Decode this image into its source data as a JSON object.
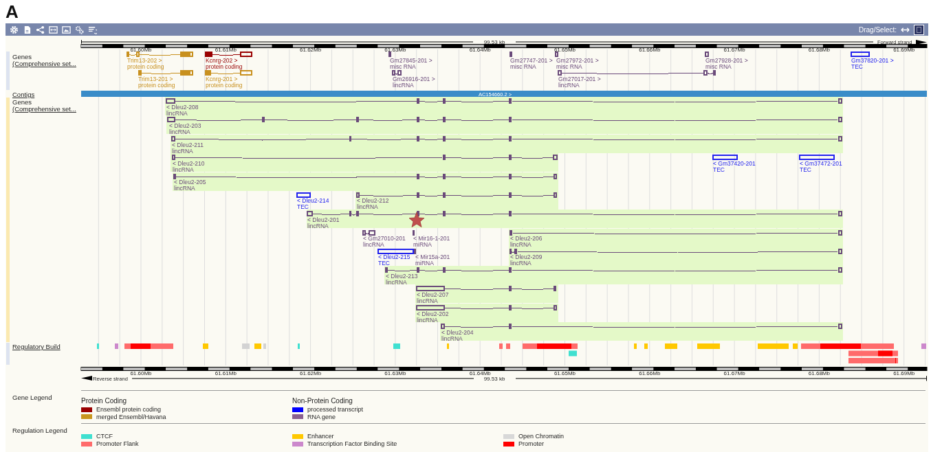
{
  "figure_label": "A",
  "toolbar": {
    "drag_select_label": "Drag/Select:"
  },
  "top_ruler": {
    "span": "99.53 kb",
    "strand": "Forward strand",
    "ticks": [
      "61.60Mb",
      "61.61Mb",
      "61.62Mb",
      "61.63Mb",
      "61.64Mb",
      "61.65Mb",
      "61.66Mb",
      "61.67Mb",
      "61.68Mb",
      "61.69Mb"
    ]
  },
  "forward_genes": {
    "label": "Genes",
    "sublabel": "(Comprehensive set...",
    "genes": [
      {
        "name": "Trim13-202 >",
        "biotype": "protein coding",
        "color": "#c8901e"
      },
      {
        "name": "Kcnrg-202 >",
        "biotype": "protein coding",
        "color": "#990000"
      },
      {
        "name": "Gm27845-201 >",
        "biotype": "misc RNA",
        "color": "#6a4a7a"
      },
      {
        "name": "Gm27747-201 >",
        "biotype": "misc RNA",
        "color": "#6a4a7a"
      },
      {
        "name": "Gm27972-201 >",
        "biotype": "misc RNA",
        "color": "#6a4a7a"
      },
      {
        "name": "Gm27928-201 >",
        "biotype": "misc RNA",
        "color": "#6a4a7a"
      },
      {
        "name": "Gm37820-201 >",
        "biotype": "TEC",
        "color": "#2222ee"
      },
      {
        "name": "Trim13-201 >",
        "biotype": "protein coding",
        "color": "#c8901e"
      },
      {
        "name": "Kcnrg-201 >",
        "biotype": "protein coding",
        "color": "#c8901e"
      },
      {
        "name": "Gm26916-201 >",
        "biotype": "lincRNA",
        "color": "#6a4a7a"
      },
      {
        "name": "Gm27017-201 >",
        "biotype": "lincRNA",
        "color": "#6a4a7a"
      }
    ]
  },
  "contigs": {
    "label": "Contigs",
    "contig": "AC154660.2 >"
  },
  "reverse_genes": {
    "label": "Genes",
    "sublabel": "(Comprehensive set...",
    "genes": [
      {
        "name": "< Dleu2-208",
        "biotype": "lincRNA",
        "color": "#6a4a7a",
        "highlighted": true
      },
      {
        "name": "< Dleu2-203",
        "biotype": "lincRNA",
        "color": "#6a4a7a",
        "highlighted": true
      },
      {
        "name": "< Dleu2-211",
        "biotype": "lincRNA",
        "color": "#6a4a7a",
        "highlighted": true
      },
      {
        "name": "< Dleu2-210",
        "biotype": "lincRNA",
        "color": "#6a4a7a",
        "highlighted": true
      },
      {
        "name": "< Gm37420-201",
        "biotype": "TEC",
        "color": "#2222ee",
        "highlighted": false
      },
      {
        "name": "< Gm37472-201",
        "biotype": "TEC",
        "color": "#2222ee",
        "highlighted": false
      },
      {
        "name": "< Dleu2-205",
        "biotype": "lincRNA",
        "color": "#6a4a7a",
        "highlighted": true
      },
      {
        "name": "< Dleu2-214",
        "biotype": "TEC",
        "color": "#2222ee",
        "highlighted": false
      },
      {
        "name": "< Dleu2-212",
        "biotype": "lincRNA",
        "color": "#6a4a7a",
        "highlighted": true
      },
      {
        "name": "< Dleu2-201",
        "biotype": "lincRNA",
        "color": "#6a4a7a",
        "highlighted": true
      },
      {
        "name": "< Gm27010-201",
        "biotype": "lincRNA",
        "color": "#6a4a7a",
        "highlighted": false
      },
      {
        "name": "< Mir16-1-201",
        "biotype": "miRNA",
        "color": "#6a4a7a",
        "highlighted": false
      },
      {
        "name": "< Dleu2-206",
        "biotype": "lincRNA",
        "color": "#6a4a7a",
        "highlighted": true
      },
      {
        "name": "< Dleu2-215",
        "biotype": "TEC",
        "color": "#2222ee",
        "highlighted": false
      },
      {
        "name": "< Mir15a-201",
        "biotype": "miRNA",
        "color": "#6a4a7a",
        "highlighted": false
      },
      {
        "name": "< Dleu2-209",
        "biotype": "lincRNA",
        "color": "#6a4a7a",
        "highlighted": true
      },
      {
        "name": "< Dleu2-213",
        "biotype": "lincRNA",
        "color": "#6a4a7a",
        "highlighted": true
      },
      {
        "name": "< Dleu2-207",
        "biotype": "lincRNA",
        "color": "#6a4a7a",
        "highlighted": true
      },
      {
        "name": "< Dleu2-202",
        "biotype": "lincRNA",
        "color": "#6a4a7a",
        "highlighted": true
      },
      {
        "name": "< Dleu2-204",
        "biotype": "lincRNA",
        "color": "#6a4a7a",
        "highlighted": true
      }
    ]
  },
  "regulatory": {
    "label": "Regulatory Build"
  },
  "bottom_ruler": {
    "ticks": [
      "61.60Mb",
      "61.61Mb",
      "61.62Mb",
      "61.63Mb",
      "61.64Mb",
      "61.65Mb",
      "61.66Mb",
      "61.67Mb",
      "61.68Mb",
      "61.69Mb"
    ],
    "strand": "Reverse strand",
    "span": "99.53 kb"
  },
  "gene_legend": {
    "title": "Gene Legend",
    "groups": [
      {
        "heading": "Protein Coding",
        "items": [
          {
            "label": "Ensembl protein coding",
            "color": "#990000"
          },
          {
            "label": "merged Ensembl/Havana",
            "color": "#c8961e"
          }
        ]
      },
      {
        "heading": "Non-Protein Coding",
        "items": [
          {
            "label": "processed transcript",
            "color": "#0000ff"
          },
          {
            "label": "RNA gene",
            "color": "#8a6090"
          }
        ]
      }
    ]
  },
  "regulation_legend": {
    "title": "Regulation Legend",
    "items": [
      {
        "label": "CTCF",
        "color": "#40e0d0"
      },
      {
        "label": "Promoter Flank",
        "color": "#ff6b6b"
      },
      {
        "label": "Enhancer",
        "color": "#ffc800"
      },
      {
        "label": "Transcription Factor Binding Site",
        "color": "#cc88cc"
      },
      {
        "label": "Open Chromatin",
        "color": "#d8d8d8"
      },
      {
        "label": "Promoter",
        "color": "#ff0000"
      }
    ]
  }
}
